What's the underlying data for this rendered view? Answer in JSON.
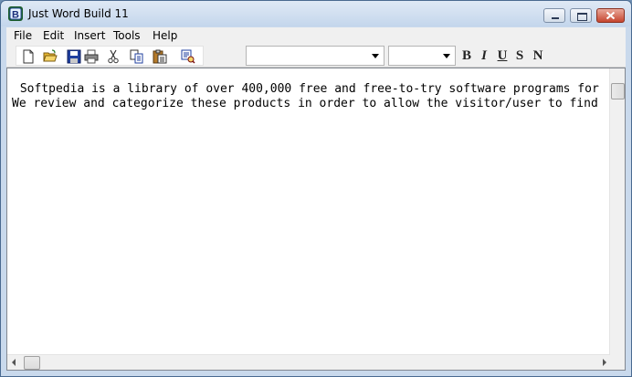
{
  "window": {
    "title": "Just Word Build 11",
    "app_icon_letter": "B"
  },
  "menubar": {
    "items": [
      "File",
      "Edit",
      "Insert",
      "Tools",
      "Help"
    ]
  },
  "toolbar": {
    "font_name_value": "",
    "font_size_value": "",
    "format_buttons": [
      "B",
      "I",
      "U",
      "S",
      "N"
    ],
    "icons": [
      "new-document-icon",
      "open-folder-icon",
      "save-disk-icon",
      "print-icon",
      "cut-scissors-icon",
      "copy-icon",
      "paste-icon",
      "find-icon"
    ]
  },
  "document": {
    "lines": [
      " Softpedia is a library of over 400,000 free and free-to-try software programs for",
      "We review and categorize these products in order to allow the visitor/user to find"
    ]
  }
}
